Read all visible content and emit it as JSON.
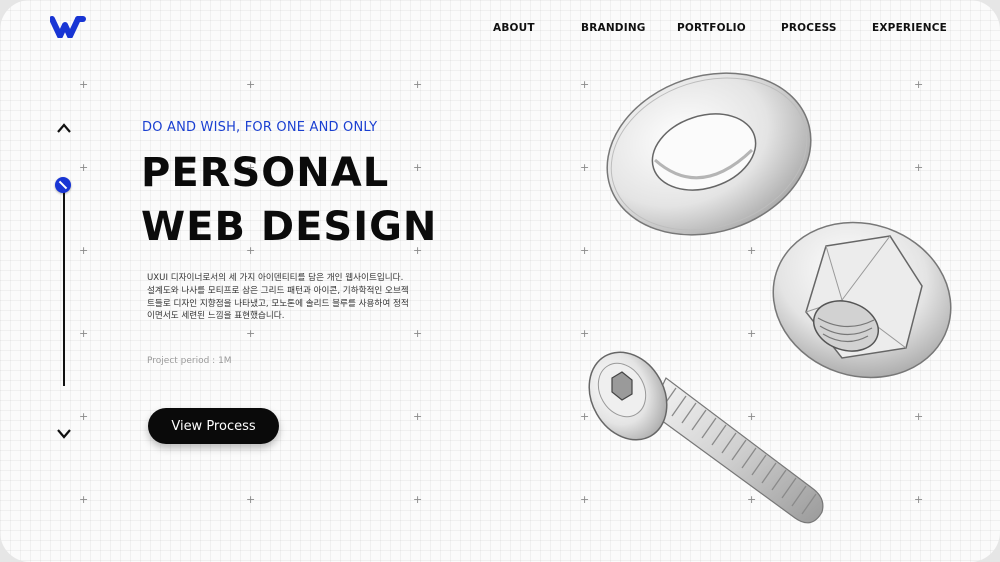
{
  "brand": {
    "logo_icon": "w-logo-icon",
    "color": "#1835d4"
  },
  "nav": {
    "items": [
      {
        "label": "ABOUT"
      },
      {
        "label": "BRANDING"
      },
      {
        "label": "PORTFOLIO"
      },
      {
        "label": "PROCESS"
      },
      {
        "label": "EXPERIENCE"
      }
    ]
  },
  "slider": {
    "up_icon": "chevron-up-icon",
    "down_icon": "chevron-down-icon",
    "position": 0
  },
  "hero": {
    "tagline": "DO AND WISH, FOR ONE AND ONLY",
    "title_line1": "PERSONAL",
    "title_line2": "WEB DESIGN",
    "description_lines": [
      "UXUI 디자이너로서의 세 가지 아이덴티티를 담은 개인 웹사이트입니다.",
      "설계도와 나사를 모티프로 삼은 그리드 패턴과 아이콘, 기하학적인 오브젝",
      "트들로 디자인 지향점을 나타냈고, 모노톤에 솔리드 블루를 사용하여 정적",
      "이면서도 세련된 느낌을 표현했습니다."
    ],
    "period": "Project period : 1M",
    "cta_label": "View Process"
  },
  "illustrations": [
    "washer-image",
    "hex-nut-image",
    "bolt-image"
  ],
  "colors": {
    "accent": "#1a3fd1",
    "text": "#0b0b0b",
    "button": "#0a0a0a"
  }
}
